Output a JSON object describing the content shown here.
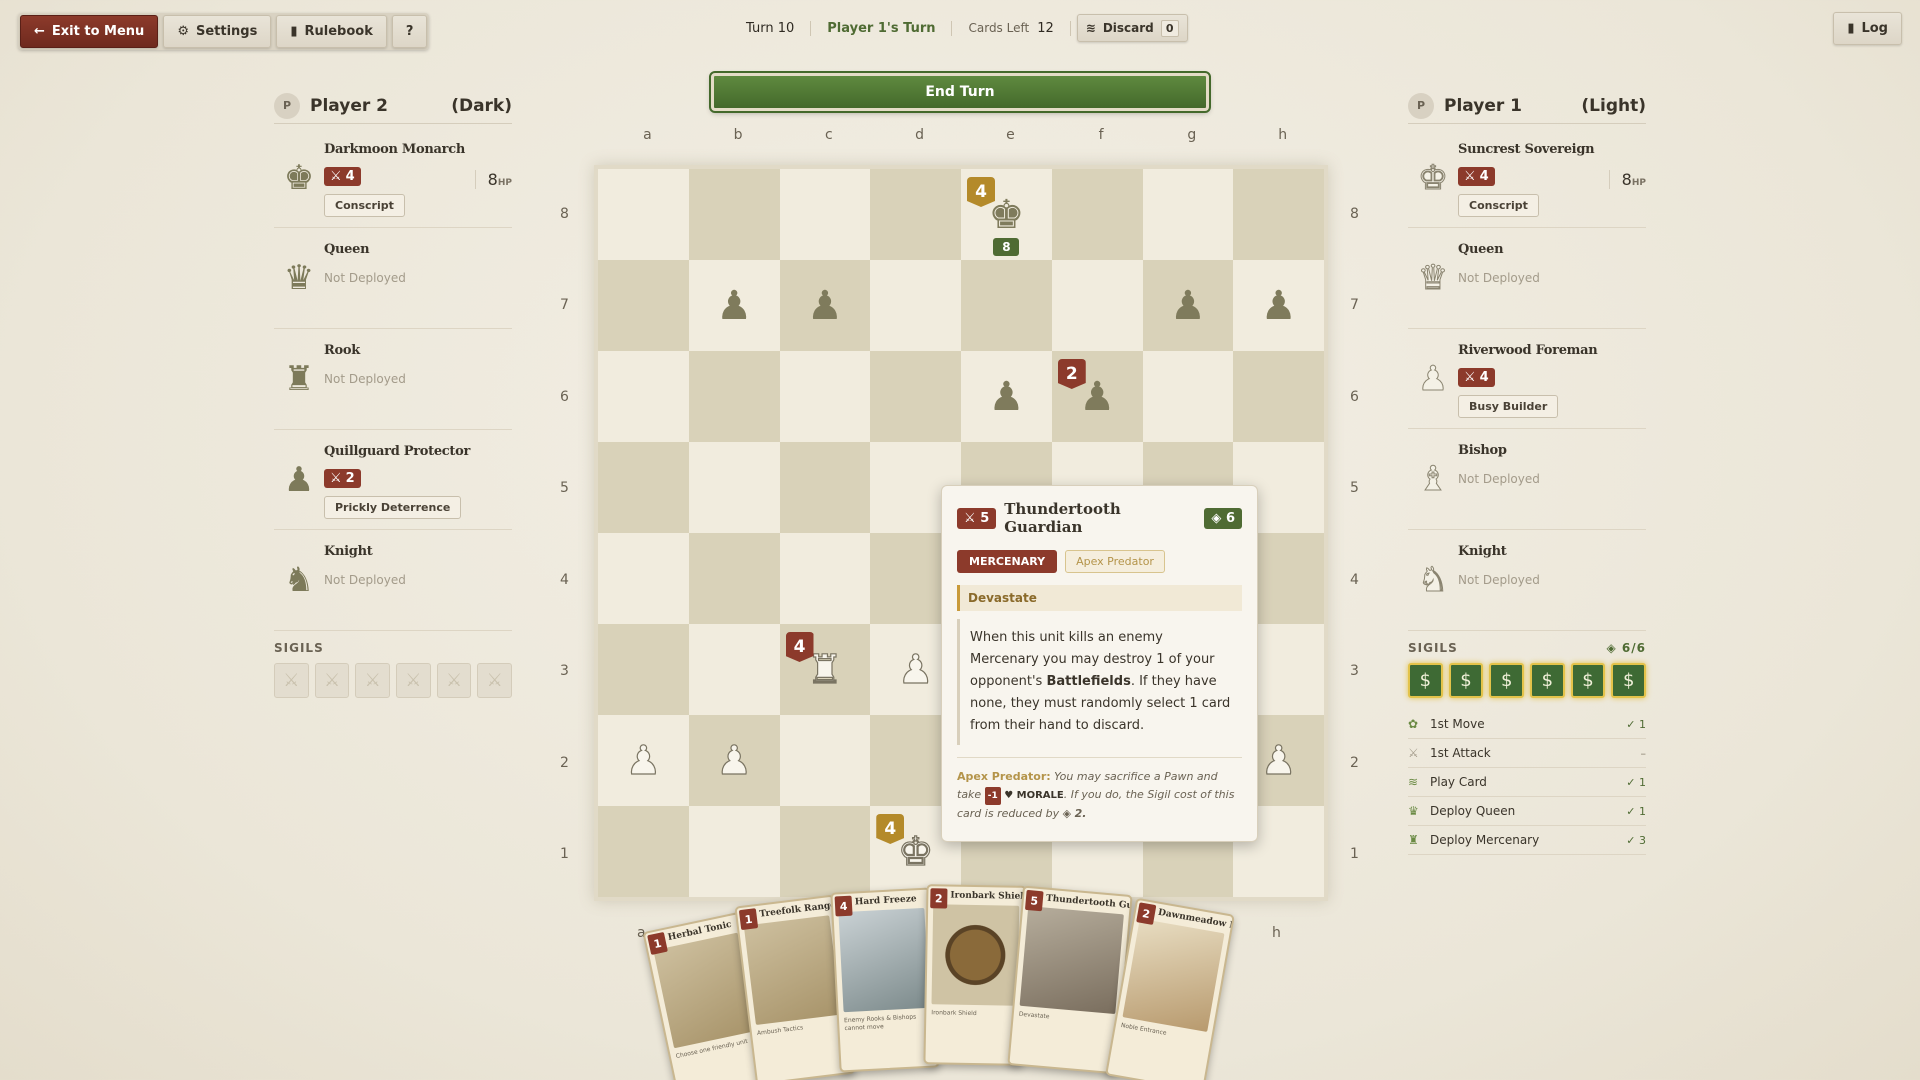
{
  "toolbar": {
    "exit_label": "Exit to Menu",
    "settings_label": "Settings",
    "rulebook_label": "Rulebook",
    "help_label": "?",
    "log_label": "Log"
  },
  "status": {
    "turn": "Turn 10",
    "current_player": "Player 1's Turn",
    "cards_left_label": "Cards Left",
    "cards_left": "12",
    "discard_label": "Discard",
    "discard_count": "0"
  },
  "end_turn_label": "End Turn",
  "player2": {
    "badge": "P",
    "name": "Player 2",
    "side": "(Dark)",
    "units": [
      {
        "name": "Darkmoon Monarch",
        "attack": "4",
        "hp": "8",
        "hp_unit": "HP",
        "ability": "Conscript",
        "piece": "king"
      },
      {
        "name": "Queen",
        "status": "Not Deployed",
        "piece": "queen"
      },
      {
        "name": "Rook",
        "status": "Not Deployed",
        "piece": "rook"
      },
      {
        "name": "Quillguard Protector",
        "attack": "2",
        "ability": "Prickly Deterrence",
        "piece": "pawn"
      },
      {
        "name": "Knight",
        "status": "Not Deployed",
        "piece": "knight"
      }
    ],
    "sigils_label": "SIGILS"
  },
  "player1": {
    "badge": "P",
    "name": "Player 1",
    "side": "(Light)",
    "units": [
      {
        "name": "Suncrest Sovereign",
        "attack": "4",
        "hp": "8",
        "hp_unit": "HP",
        "ability": "Conscript",
        "piece": "king"
      },
      {
        "name": "Queen",
        "status": "Not Deployed",
        "piece": "queen"
      },
      {
        "name": "Riverwood Foreman",
        "attack": "4",
        "ability": "Busy Builder",
        "piece": "pawn"
      },
      {
        "name": "Bishop",
        "status": "Not Deployed",
        "piece": "bishop"
      },
      {
        "name": "Knight",
        "status": "Not Deployed",
        "piece": "knight"
      }
    ],
    "sigils_label": "SIGILS",
    "sigils_count": "6/6",
    "actions": [
      {
        "label": "1st Move",
        "cost": "✓ 1"
      },
      {
        "label": "1st Attack",
        "cost": "–"
      },
      {
        "label": "Play Card",
        "cost": "✓ 1"
      },
      {
        "label": "Deploy Queen",
        "cost": "✓ 1"
      },
      {
        "label": "Deploy Mercenary",
        "cost": "✓ 3"
      }
    ]
  },
  "board": {
    "files": [
      "a",
      "b",
      "c",
      "d",
      "e",
      "f",
      "g",
      "h"
    ],
    "ranks": [
      "8",
      "7",
      "6",
      "5",
      "4",
      "3",
      "2",
      "1"
    ],
    "bottom_files": [
      "a",
      "h"
    ]
  },
  "tooltip": {
    "attack": "5",
    "name": "Thundertooth Guardian",
    "cost": "6",
    "tag_type": "MERCENARY",
    "tag_keyword": "Apex Predator",
    "ability_name": "Devastate",
    "desc_1": "When this unit kills an enemy Mercenary you may destroy 1 of your opponent's ",
    "desc_bold": "Battlefields",
    "desc_2": ". If they have none, they must randomly select 1 card from their hand to discard.",
    "apex_label": "Apex Predator:",
    "apex_text_1": " You may sacrifice a Pawn and take ",
    "apex_badge": "-1",
    "apex_morale": "♥ MORALE",
    "apex_text_2": ". If you do, the Sigil cost of this card is reduced by ",
    "apex_reduce": "2."
  },
  "hand": [
    {
      "title": "Herbal Tonic",
      "cost": "1",
      "text": "Choose one friendly unit"
    },
    {
      "title": "Treefolk Ranger",
      "cost": "1",
      "text": "Ambush Tactics"
    },
    {
      "title": "Hard Freeze",
      "cost": "4",
      "text": "Enemy Rooks & Bishops cannot move"
    },
    {
      "title": "Ironbark Shield",
      "cost": "2",
      "text": "Ironbark Shield"
    },
    {
      "title": "Thundertooth Guardian",
      "cost": "5",
      "text": "Devastate"
    },
    {
      "title": "Dawnmeadow Regent",
      "cost": "2",
      "text": "Noble Entrance"
    }
  ]
}
